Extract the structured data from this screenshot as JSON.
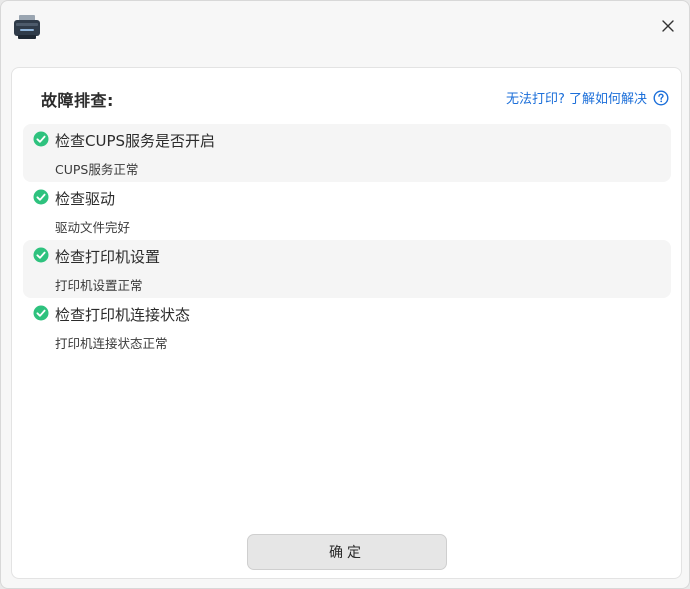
{
  "window": {
    "app_icon": "printer-icon",
    "close_icon": "close-icon"
  },
  "panel": {
    "heading": "故障排查:",
    "help_link": {
      "label": "无法打印? 了解如何解决",
      "icon": "question-circle-icon"
    },
    "checks": [
      {
        "title": "检查CUPS服务是否开启",
        "status": "CUPS服务正常",
        "state": "ok"
      },
      {
        "title": "检查驱动",
        "status": "驱动文件完好",
        "state": "ok"
      },
      {
        "title": "检查打印机设置",
        "status": "打印机设置正常",
        "state": "ok"
      },
      {
        "title": "检查打印机连接状态",
        "status": "打印机连接状态正常",
        "state": "ok"
      }
    ],
    "ok_button": "确定"
  },
  "colors": {
    "accent": "#1c6fd9",
    "success": "#2ec27e"
  }
}
